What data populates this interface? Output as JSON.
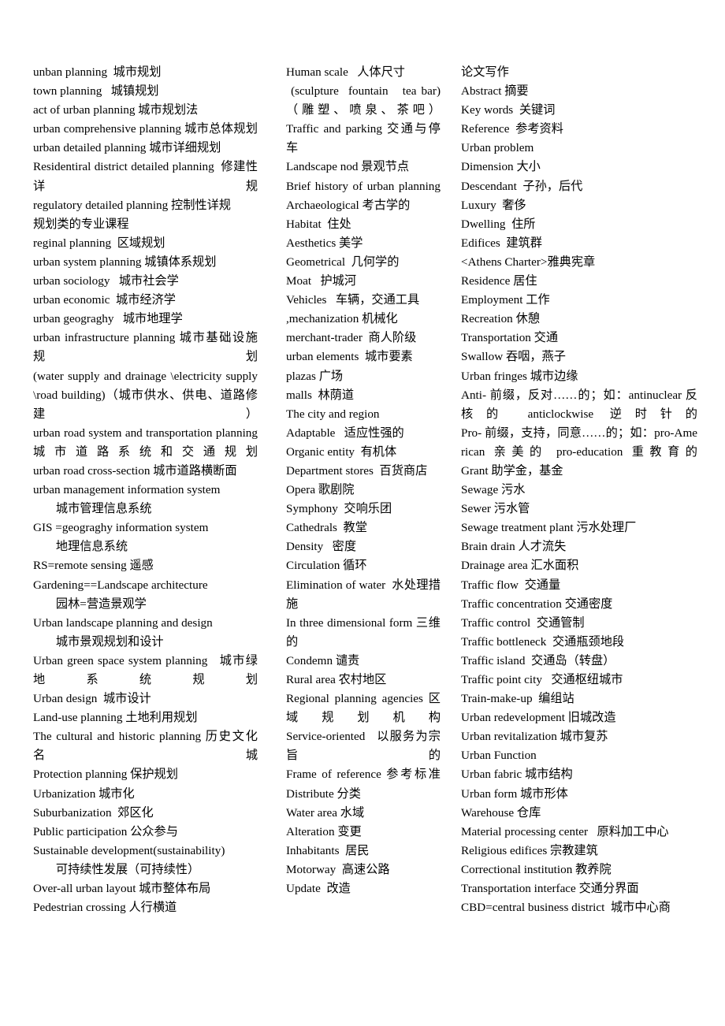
{
  "document": {
    "title": "Urban Planning Bilingual Glossary",
    "page_background": "#ffffff",
    "text_color": "#000000",
    "column_count": 3
  },
  "columns": [
    {
      "id": "column-1",
      "entries": [
        {
          "id": "c1-e1",
          "text": "unban planning  城市规划",
          "justified": false
        },
        {
          "id": "c1-e2",
          "text": "town planning   城镇规划",
          "justified": false
        },
        {
          "id": "c1-e3",
          "text": "act of urban planning 城市规划法",
          "justified": false
        },
        {
          "id": "c1-e4",
          "text": "urban comprehensive planning 城市总体规划",
          "justified": true
        },
        {
          "id": "c1-e5",
          "text": "urban detailed planning 城市详细规划",
          "justified": false
        },
        {
          "id": "c1-e6",
          "text": "Residentiral district detailed planning  修建性详规",
          "justified": true
        },
        {
          "id": "c1-e7",
          "text": "regulatory detailed planning 控制性详规",
          "justified": false
        },
        {
          "id": "c1-e8",
          "text": "规划类的专业课程",
          "justified": false
        },
        {
          "id": "c1-e9",
          "text": "reginal planning  区域规划",
          "justified": false
        },
        {
          "id": "c1-e10",
          "text": "urban system planning 城镇体系规划",
          "justified": false
        },
        {
          "id": "c1-e11",
          "text": "urban sociology   城市社会学",
          "justified": false
        },
        {
          "id": "c1-e12",
          "text": "urban economic  城市经济学",
          "justified": false
        },
        {
          "id": "c1-e13",
          "text": "urban geograghy   城市地理学",
          "justified": false
        },
        {
          "id": "c1-e14",
          "text": "urban infrastructure planning 城市基础设施规划",
          "justified": true
        },
        {
          "id": "c1-e15",
          "text": "(water supply and drainage \\electricity supply\\road building)（城市供水、供电、道路修建）",
          "justified": true
        },
        {
          "id": "c1-e16",
          "text": "urban road system and transportation planning 城市道路系统和交通规划",
          "justified": true
        },
        {
          "id": "c1-e17",
          "text": "urban road cross-section 城市道路横断面",
          "justified": false
        },
        {
          "id": "c1-e18",
          "text": "urban management information system",
          "justified": false
        },
        {
          "id": "c1-e19",
          "text": "城市管理信息系统",
          "indented": true,
          "justified": false
        },
        {
          "id": "c1-e20",
          "text": "GIS =geograghy information system",
          "justified": false
        },
        {
          "id": "c1-e21",
          "text": "地理信息系统",
          "indented": true,
          "justified": false
        },
        {
          "id": "c1-e22",
          "text": "RS=remote sensing 遥感",
          "justified": false
        },
        {
          "id": "c1-e23",
          "text": "Gardening==Landscape architecture",
          "justified": false
        },
        {
          "id": "c1-e24",
          "text": "园林=营造景观学",
          "indented": true,
          "justified": false
        },
        {
          "id": "c1-e25",
          "text": "Urban landscape planning and design",
          "justified": false
        },
        {
          "id": "c1-e26",
          "text": "城市景观规划和设计",
          "indented": true,
          "justified": false
        },
        {
          "id": "c1-e27",
          "text": "Urban green space system planning   城市绿地系统规划",
          "justified": true
        },
        {
          "id": "c1-e28",
          "text": "Urban design  城市设计",
          "justified": false
        },
        {
          "id": "c1-e29",
          "text": "Land-use planning 土地利用规划",
          "justified": false
        },
        {
          "id": "c1-e30",
          "text": "The cultural and historic planning 历史文化名城",
          "justified": true
        },
        {
          "id": "c1-e31",
          "text": "Protection planning 保护规划",
          "justified": false
        },
        {
          "id": "c1-e32",
          "text": "Urbanization 城市化",
          "justified": false
        },
        {
          "id": "c1-e33",
          "text": "Suburbanization  郊区化",
          "justified": false
        },
        {
          "id": "c1-e34",
          "text": "Public participation 公众参与",
          "justified": false
        },
        {
          "id": "c1-e35",
          "text": "Sustainable development(sustainability)",
          "justified": false
        },
        {
          "id": "c1-e36",
          "text": "可持续性发展（可持续性）",
          "indented": true,
          "justified": false
        },
        {
          "id": "c1-e37",
          "text": "Over-all urban layout 城市整体布局",
          "justified": false
        },
        {
          "id": "c1-e38",
          "text": "Pedestrian crossing 人行横道",
          "justified": false
        }
      ]
    },
    {
      "id": "column-2",
      "entries": [
        {
          "id": "c2-e1",
          "text": "Human scale   人体尺寸",
          "justified": false
        },
        {
          "id": "c2-e2",
          "text": " (sculpture  fountain   tea bar)（雕塑、喷泉、茶吧）",
          "justified": true
        },
        {
          "id": "c2-e3",
          "text": "Traffic and parking 交通与停车",
          "justified": true
        },
        {
          "id": "c2-e4",
          "text": "Landscape nod 景观节点",
          "justified": false
        },
        {
          "id": "c2-e5",
          "text": "Brief history of urban planning",
          "justified": true
        },
        {
          "id": "c2-e6",
          "text": "Archaeological 考古学的",
          "justified": false
        },
        {
          "id": "c2-e7",
          "text": "Habitat  住处",
          "justified": false
        },
        {
          "id": "c2-e8",
          "text": "Aesthetics 美学",
          "justified": false
        },
        {
          "id": "c2-e9",
          "text": "Geometrical  几何学的",
          "justified": false
        },
        {
          "id": "c2-e10",
          "text": "Moat   护城河",
          "justified": false
        },
        {
          "id": "c2-e11",
          "text": "Vehicles   车辆，交通工具",
          "justified": false
        },
        {
          "id": "c2-e12",
          "text": ",mechanization 机械化",
          "justified": false
        },
        {
          "id": "c2-e13",
          "text": "merchant-trader  商人阶级",
          "justified": false
        },
        {
          "id": "c2-e14",
          "text": "urban elements  城市要素",
          "justified": false
        },
        {
          "id": "c2-e15",
          "text": "plazas 广场",
          "justified": false
        },
        {
          "id": "c2-e16",
          "text": "malls  林荫道",
          "justified": false
        },
        {
          "id": "c2-e17",
          "text": "The city and region",
          "justified": false
        },
        {
          "id": "c2-e18",
          "text": "Adaptable   适应性强的",
          "justified": false
        },
        {
          "id": "c2-e19",
          "text": "Organic entity  有机体",
          "justified": false
        },
        {
          "id": "c2-e20",
          "text": "Department stores  百货商店",
          "justified": false
        },
        {
          "id": "c2-e21",
          "text": "Opera 歌剧院",
          "justified": false
        },
        {
          "id": "c2-e22",
          "text": "Symphony  交响乐团",
          "justified": false
        },
        {
          "id": "c2-e23",
          "text": "Cathedrals  教堂",
          "justified": false
        },
        {
          "id": "c2-e24",
          "text": "Density   密度",
          "justified": false
        },
        {
          "id": "c2-e25",
          "text": "Circulation 循环",
          "justified": false
        },
        {
          "id": "c2-e26",
          "text": "Elimination of water  水处理措施",
          "justified": true
        },
        {
          "id": "c2-e27",
          "text": "In three dimensional form 三维的",
          "justified": true
        },
        {
          "id": "c2-e28",
          "text": "Condemn 谴责",
          "justified": false
        },
        {
          "id": "c2-e29",
          "text": "Rural area 农村地区",
          "justified": false
        },
        {
          "id": "c2-e30",
          "text": "Regional planning agencies 区域规划机构",
          "justified": true
        },
        {
          "id": "c2-e31",
          "text": "Service-oriented   以服务为宗旨的",
          "justified": true
        },
        {
          "id": "c2-e32",
          "text": "Frame of reference 参考标准",
          "justified": true
        },
        {
          "id": "c2-e33",
          "text": "Distribute 分类",
          "justified": false
        },
        {
          "id": "c2-e34",
          "text": "Water area 水域",
          "justified": false
        },
        {
          "id": "c2-e35",
          "text": "Alteration 变更",
          "justified": false
        },
        {
          "id": "c2-e36",
          "text": "Inhabitants  居民",
          "justified": false
        },
        {
          "id": "c2-e37",
          "text": "Motorway  高速公路",
          "justified": false
        },
        {
          "id": "c2-e38",
          "text": "Update  改造",
          "justified": false
        }
      ]
    },
    {
      "id": "column-3",
      "entries": [
        {
          "id": "c3-e1",
          "text": "论文写作",
          "justified": false
        },
        {
          "id": "c3-e2",
          "text": "Abstract 摘要",
          "justified": false
        },
        {
          "id": "c3-e3",
          "text": "Key words  关键词",
          "justified": false
        },
        {
          "id": "c3-e4",
          "text": "Reference  参考资料",
          "justified": false
        },
        {
          "id": "c3-e5",
          "text": "Urban problem",
          "justified": false
        },
        {
          "id": "c3-e6",
          "text": "Dimension 大小",
          "justified": false
        },
        {
          "id": "c3-e7",
          "text": "Descendant  子孙，后代",
          "justified": false
        },
        {
          "id": "c3-e8",
          "text": "Luxury  奢侈",
          "justified": false
        },
        {
          "id": "c3-e9",
          "text": "Dwelling  住所",
          "justified": false
        },
        {
          "id": "c3-e10",
          "text": "Edifices  建筑群",
          "justified": false
        },
        {
          "id": "c3-e11",
          "text": "<Athens Charter>雅典宪章",
          "justified": false
        },
        {
          "id": "c3-e12",
          "text": "Residence 居住",
          "justified": false
        },
        {
          "id": "c3-e13",
          "text": "Employment 工作",
          "justified": false
        },
        {
          "id": "c3-e14",
          "text": "Recreation 休憩",
          "justified": false
        },
        {
          "id": "c3-e15",
          "text": "Transportation 交通",
          "justified": false
        },
        {
          "id": "c3-e16",
          "text": "Swallow 吞咽，燕子",
          "justified": false
        },
        {
          "id": "c3-e17",
          "text": "Urban fringes 城市边缘",
          "justified": false
        },
        {
          "id": "c3-e18",
          "text": "Anti- 前缀，反对……的；如：antinuclear 反核的 anticlockwise 逆时针的",
          "justified": true
        },
        {
          "id": "c3-e19",
          "text": "Pro- 前缀，支持，同意……的；如：pro-American 亲美的 pro-education 重教育的",
          "justified": true
        },
        {
          "id": "c3-e20",
          "text": "Grant 助学金，基金",
          "justified": false
        },
        {
          "id": "c3-e21",
          "text": "Sewage 污水",
          "justified": false
        },
        {
          "id": "c3-e22",
          "text": "Sewer 污水管",
          "justified": false
        },
        {
          "id": "c3-e23",
          "text": "Sewage treatment plant 污水处理厂",
          "justified": false
        },
        {
          "id": "c3-e24",
          "text": "Brain drain 人才流失",
          "justified": false
        },
        {
          "id": "c3-e25",
          "text": "Drainage area 汇水面积",
          "justified": false
        },
        {
          "id": "c3-e26",
          "text": "Traffic flow  交通量",
          "justified": false
        },
        {
          "id": "c3-e27",
          "text": "Traffic concentration 交通密度",
          "justified": false
        },
        {
          "id": "c3-e28",
          "text": "Traffic control  交通管制",
          "justified": false
        },
        {
          "id": "c3-e29",
          "text": "Traffic bottleneck  交通瓶颈地段",
          "justified": false
        },
        {
          "id": "c3-e30",
          "text": "Traffic island  交通岛（转盘）",
          "justified": false
        },
        {
          "id": "c3-e31",
          "text": "Traffic point city   交通枢纽城市",
          "justified": false
        },
        {
          "id": "c3-e32",
          "text": "Train-make-up  编组站",
          "justified": false
        },
        {
          "id": "c3-e33",
          "text": "Urban redevelopment 旧城改造",
          "justified": false
        },
        {
          "id": "c3-e34",
          "text": "Urban revitalization 城市复苏",
          "justified": false
        },
        {
          "id": "c3-e35",
          "text": "Urban Function",
          "justified": false
        },
        {
          "id": "c3-e36",
          "text": "Urban fabric 城市结构",
          "justified": false
        },
        {
          "id": "c3-e37",
          "text": "Urban form 城市形体",
          "justified": false
        },
        {
          "id": "c3-e38",
          "text": "Warehouse 仓库",
          "justified": false
        },
        {
          "id": "c3-e39",
          "text": "Material processing center   原料加工中心",
          "justified": false
        },
        {
          "id": "c3-e40",
          "text": "Religious edifices 宗教建筑",
          "justified": false
        },
        {
          "id": "c3-e41",
          "text": "Correctional institution 教养院",
          "justified": false
        },
        {
          "id": "c3-e42",
          "text": "Transportation interface 交通分界面",
          "justified": false
        },
        {
          "id": "c3-e43",
          "text": "CBD=central business district  城市中心商",
          "justified": false
        }
      ]
    }
  ]
}
